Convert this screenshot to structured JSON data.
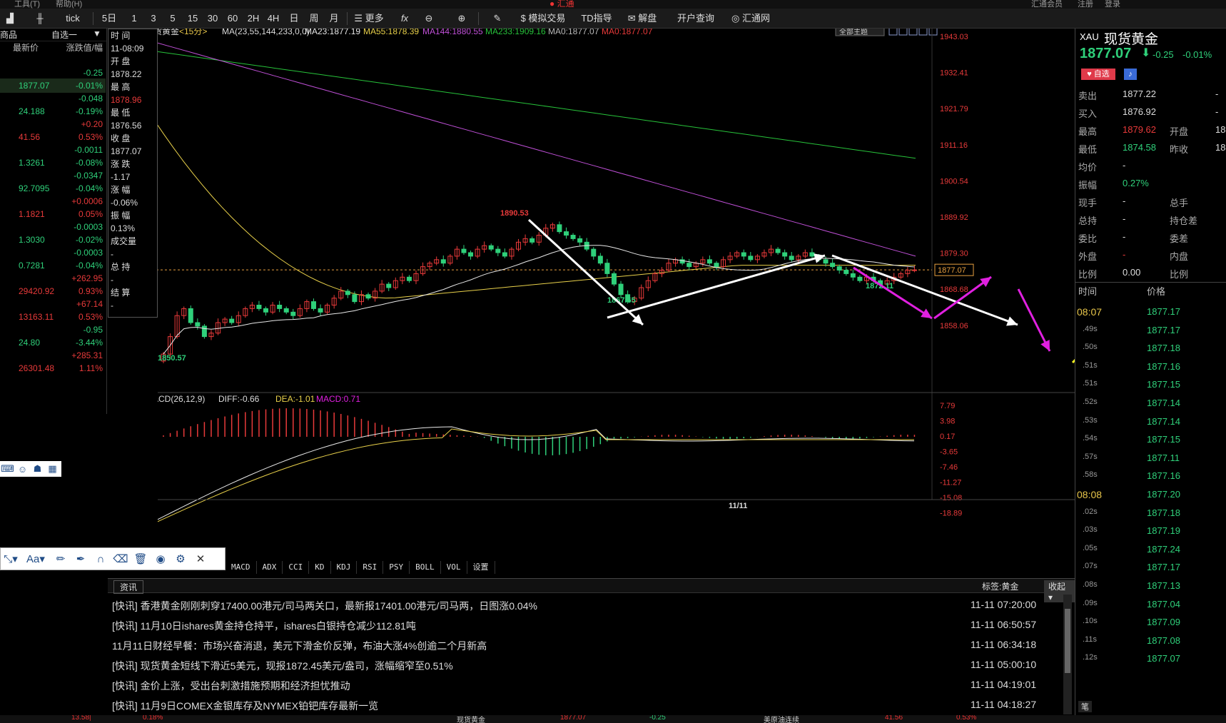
{
  "app": {
    "name": "汇通",
    "top_labels": [
      "工具(T)",
      "帮助(H)",
      "汇通会员",
      "注册",
      "登录"
    ]
  },
  "colors": {
    "up": "#e83a3a",
    "down": "#2fd07a",
    "accent": "#e8c64a",
    "bg": "#000000",
    "magenta": "#e020e0",
    "green_ma": "#27c23a",
    "purple_ma": "#c050d8"
  },
  "toolbar": {
    "periods": [
      "tick",
      "5日",
      "1",
      "3",
      "5",
      "15",
      "30",
      "60",
      "2H",
      "4H",
      "日",
      "周",
      "月"
    ],
    "more": "更多",
    "fx": "fx",
    "mock_trade": "模拟交易",
    "td_guide": "TD指导",
    "unlock": "解盘",
    "open_account": "开户查询",
    "huitong": "汇通网"
  },
  "watchlist": {
    "tab_label": "商品",
    "tab_self": "自选一",
    "col_price": "最新价",
    "col_change": "涨跌值/幅",
    "rows": [
      {
        "change": "-0.25",
        "price": "1877.07",
        "pct": "-0.01%",
        "dir": "down"
      },
      {
        "change": "-0.048",
        "price": "24.188",
        "pct": "-0.19%",
        "dir": "down"
      },
      {
        "change": "+0.20",
        "price": "41.56",
        "pct": "0.53%",
        "dir": "up"
      },
      {
        "change": "-0.0011",
        "price": "1.3261",
        "pct": "-0.08%",
        "dir": "down"
      },
      {
        "change": "-0.0347",
        "price": "92.7095",
        "pct": "-0.04%",
        "dir": "down"
      },
      {
        "change": "+0.0006",
        "price": "1.1821",
        "pct": "0.05%",
        "dir": "up"
      },
      {
        "change": "-0.0003",
        "price": "1.3030",
        "pct": "-0.02%",
        "dir": "down"
      },
      {
        "change": "-0.0003",
        "price": "0.7281",
        "pct": "-0.04%",
        "dir": "down"
      },
      {
        "change": "+262.95",
        "price": "29420.92",
        "pct": "0.93%",
        "dir": "up"
      },
      {
        "change": "+67.14",
        "price": "13163.11",
        "pct": "0.53%",
        "dir": "up"
      },
      {
        "change": "-0.95",
        "price": "24.80",
        "pct": "-3.44%",
        "dir": "down"
      },
      {
        "change": "+285.31",
        "price": "26301.48",
        "pct": "1.11%",
        "dir": "up"
      }
    ]
  },
  "ohlc_panel": {
    "items": [
      "时 间",
      "11-08:09",
      "开 盘",
      "1878.22",
      "最 高",
      "1878.96",
      "最 低",
      "1876.56",
      "收 盘",
      "1877.07",
      "涨 跌",
      "-1.17",
      "涨 幅",
      "-0.06%",
      "振 幅",
      "0.13%",
      "成交量",
      "-",
      "总 持",
      "-",
      "结 算",
      "-"
    ]
  },
  "chart": {
    "title": "现货黄金",
    "period": "<15分>",
    "ma_spec": "MA(23,55,144,233,0,0)",
    "ma_legend": [
      {
        "label": "MA23:1877.19",
        "color": "#e8e8e8"
      },
      {
        "label": "MA55:1878.39",
        "color": "#e8d04a"
      },
      {
        "label": "MA144:1880.55",
        "color": "#c050d8"
      },
      {
        "label": "MA233:1909.16",
        "color": "#27c23a"
      },
      {
        "label": "MA0:1877.07",
        "color": "#bbbbbb"
      },
      {
        "label": "MA0:1877.07",
        "color": "#e83a3a"
      }
    ],
    "theme_btn": "全部主题",
    "y_labels_right": [
      "1943.03",
      "1932.41",
      "1921.79",
      "1911.16",
      "1900.54",
      "1889.92",
      "1879.30",
      "1868.68",
      "1858.06"
    ],
    "y_label_left": "1858.06",
    "current_price_tag": "1877.07",
    "annotations": [
      {
        "text": "1890.53",
        "color": "#e83a3a"
      },
      {
        "text": "1867.65",
        "color": "#2fd07a"
      },
      {
        "text": "1850.57",
        "color": "#2fd07a"
      },
      {
        "text": "1872.11",
        "color": "#2fd07a"
      }
    ],
    "x_label": "11/11"
  },
  "macd": {
    "spec": "MACD(26,12,9)",
    "diff": "DIFF:-0.66",
    "dea": "DEA:-1.01",
    "macd": "MACD:0.71",
    "y_labels": [
      "7.79",
      "3.98",
      "0.17",
      "-3.65",
      "-7.46",
      "-11.27",
      "-15.08",
      "-18.89"
    ]
  },
  "indicator_tabs": [
    "MACD",
    "ADX",
    "CCI",
    "KD",
    "KDJ",
    "RSI",
    "PSY",
    "BOLL",
    "VOL",
    "设置"
  ],
  "news": {
    "tab": "资讯",
    "tag": "标签:黄金",
    "collapse": "收起",
    "items": [
      {
        "text": "[快讯] 香港黄金刚刚刺穿17400.00港元/司马两关口，最新报17401.00港元/司马两，日图涨0.04%",
        "time": "11-11 07:20:00"
      },
      {
        "text": "[快讯] 11月10日ishares黄金持仓持平，ishares白银持仓减少112.81吨",
        "time": "11-11 06:50:57"
      },
      {
        "text": "11月11日财经早餐：市场兴奋消退，美元下滑金价反弹，布油大涨4%创逾二个月新高",
        "time": "11-11 06:34:18"
      },
      {
        "text": "[快讯] 现货黄金短线下滑近5美元，现报1872.45美元/盎司，涨幅缩窄至0.51%",
        "time": "11-11 05:00:10"
      },
      {
        "text": "[快讯] 金价上涨，受出台刺激措施预期和经济担忧推动",
        "time": "11-11 04:19:01"
      },
      {
        "text": "[快讯] 11月9日COMEX金银库存及NYMEX铂钯库存最新一览",
        "time": "11-11 04:18:27"
      }
    ]
  },
  "quote": {
    "code": "XAU",
    "name": "现货黄金",
    "price": "1877.07",
    "change": "-0.25",
    "pct": "-0.01%",
    "add_fav": "自选",
    "rows": [
      {
        "l1": "卖出",
        "v1": "1877.22",
        "c1": "#dddddd",
        "l2": "",
        "v2": "-"
      },
      {
        "l1": "买入",
        "v1": "1876.92",
        "c1": "#dddddd",
        "l2": "",
        "v2": "-"
      },
      {
        "l1": "最高",
        "v1": "1879.62",
        "c1": "#e83a3a",
        "l2": "开盘",
        "v2": "18"
      },
      {
        "l1": "最低",
        "v1": "1874.58",
        "c1": "#2fd07a",
        "l2": "昨收",
        "v2": "18"
      },
      {
        "l1": "均价",
        "v1": "-",
        "c1": "#dddddd",
        "l2": "",
        "v2": ""
      },
      {
        "l1": "振幅",
        "v1": "0.27%",
        "c1": "#2fd07a",
        "l2": "",
        "v2": ""
      },
      {
        "l1": "现手",
        "v1": "-",
        "c1": "#dddddd",
        "l2": "总手",
        "v2": ""
      },
      {
        "l1": "总持",
        "v1": "-",
        "c1": "#dddddd",
        "l2": "持仓差",
        "v2": ""
      },
      {
        "l1": "委比",
        "v1": "-",
        "c1": "#dddddd",
        "l2": "委差",
        "v2": ""
      },
      {
        "l1": "外盘",
        "v1": "-",
        "c1": "#e83a3a",
        "l2": "内盘",
        "v2": ""
      },
      {
        "l1": "比例",
        "v1": "0.00",
        "c1": "#dddddd",
        "l2": "比例",
        "v2": ""
      }
    ],
    "tick_header_time": "时间",
    "tick_header_price": "价格",
    "ticks": [
      {
        "t": "08:07",
        "p": "1877.17",
        "hl": true
      },
      {
        "t": ".49s",
        "p": "1877.17",
        "hl": false
      },
      {
        "t": ".50s",
        "p": "1877.18",
        "hl": false
      },
      {
        "t": ".51s",
        "p": "1877.16",
        "hl": false
      },
      {
        "t": ".51s",
        "p": "1877.15",
        "hl": false
      },
      {
        "t": ".52s",
        "p": "1877.14",
        "hl": false
      },
      {
        "t": ".53s",
        "p": "1877.14",
        "hl": false
      },
      {
        "t": ".54s",
        "p": "1877.15",
        "hl": false
      },
      {
        "t": ".57s",
        "p": "1877.11",
        "hl": false
      },
      {
        "t": ".58s",
        "p": "1877.16",
        "hl": false
      },
      {
        "t": "08:08",
        "p": "1877.20",
        "hl": true
      },
      {
        "t": ".02s",
        "p": "1877.18",
        "hl": false
      },
      {
        "t": ".03s",
        "p": "1877.19",
        "hl": false
      },
      {
        "t": ".05s",
        "p": "1877.24",
        "hl": false
      },
      {
        "t": ".07s",
        "p": "1877.17",
        "hl": false
      },
      {
        "t": ".08s",
        "p": "1877.13",
        "hl": false
      },
      {
        "t": ".09s",
        "p": "1877.04",
        "hl": false
      },
      {
        "t": ".10s",
        "p": "1877.09",
        "hl": false
      },
      {
        "t": ".11s",
        "p": "1877.08",
        "hl": false
      },
      {
        "t": ".12s",
        "p": "1877.07",
        "hl": false
      }
    ],
    "footer_tab": "笔"
  },
  "status": {
    "items": [
      "13.58|",
      "0.18%",
      "现货黄金",
      "1877.07",
      "-0.25",
      "美原油连续",
      "41.56",
      "0.53%"
    ]
  },
  "chart_data": {
    "type": "candlestick",
    "ylim": [
      1850.57,
      1943.03
    ],
    "close_series": [
      1853,
      1858,
      1864,
      1866,
      1862,
      1861,
      1858,
      1859,
      1862,
      1863,
      1862,
      1864,
      1866,
      1867,
      1866,
      1865,
      1867,
      1866,
      1865,
      1864,
      1866,
      1868,
      1866,
      1865,
      1867,
      1869,
      1871,
      1870,
      1868,
      1870,
      1869,
      1871,
      1873,
      1872,
      1874,
      1875,
      1874,
      1876,
      1878,
      1879,
      1880,
      1879,
      1881,
      1883,
      1882,
      1881,
      1883,
      1884,
      1883,
      1882,
      1881,
      1883,
      1885,
      1886,
      1885,
      1887,
      1889,
      1890,
      1888,
      1887,
      1886,
      1885,
      1883,
      1881,
      1879,
      1876,
      1873,
      1870,
      1868,
      1869,
      1872,
      1874,
      1876,
      1877,
      1879,
      1880,
      1879,
      1878,
      1879,
      1880,
      1879,
      1878,
      1880,
      1881,
      1882,
      1881,
      1880,
      1881,
      1882,
      1883,
      1882,
      1881,
      1880,
      1881,
      1882,
      1881,
      1880,
      1879,
      1878,
      1877,
      1876,
      1875,
      1874,
      1875,
      1874,
      1873,
      1874,
      1875,
      1876,
      1877,
      1877.07
    ],
    "ma23_end": 1877.19,
    "ma55_end": 1878.39,
    "ma144_end": 1880.55,
    "ma233_end": 1909.16
  }
}
